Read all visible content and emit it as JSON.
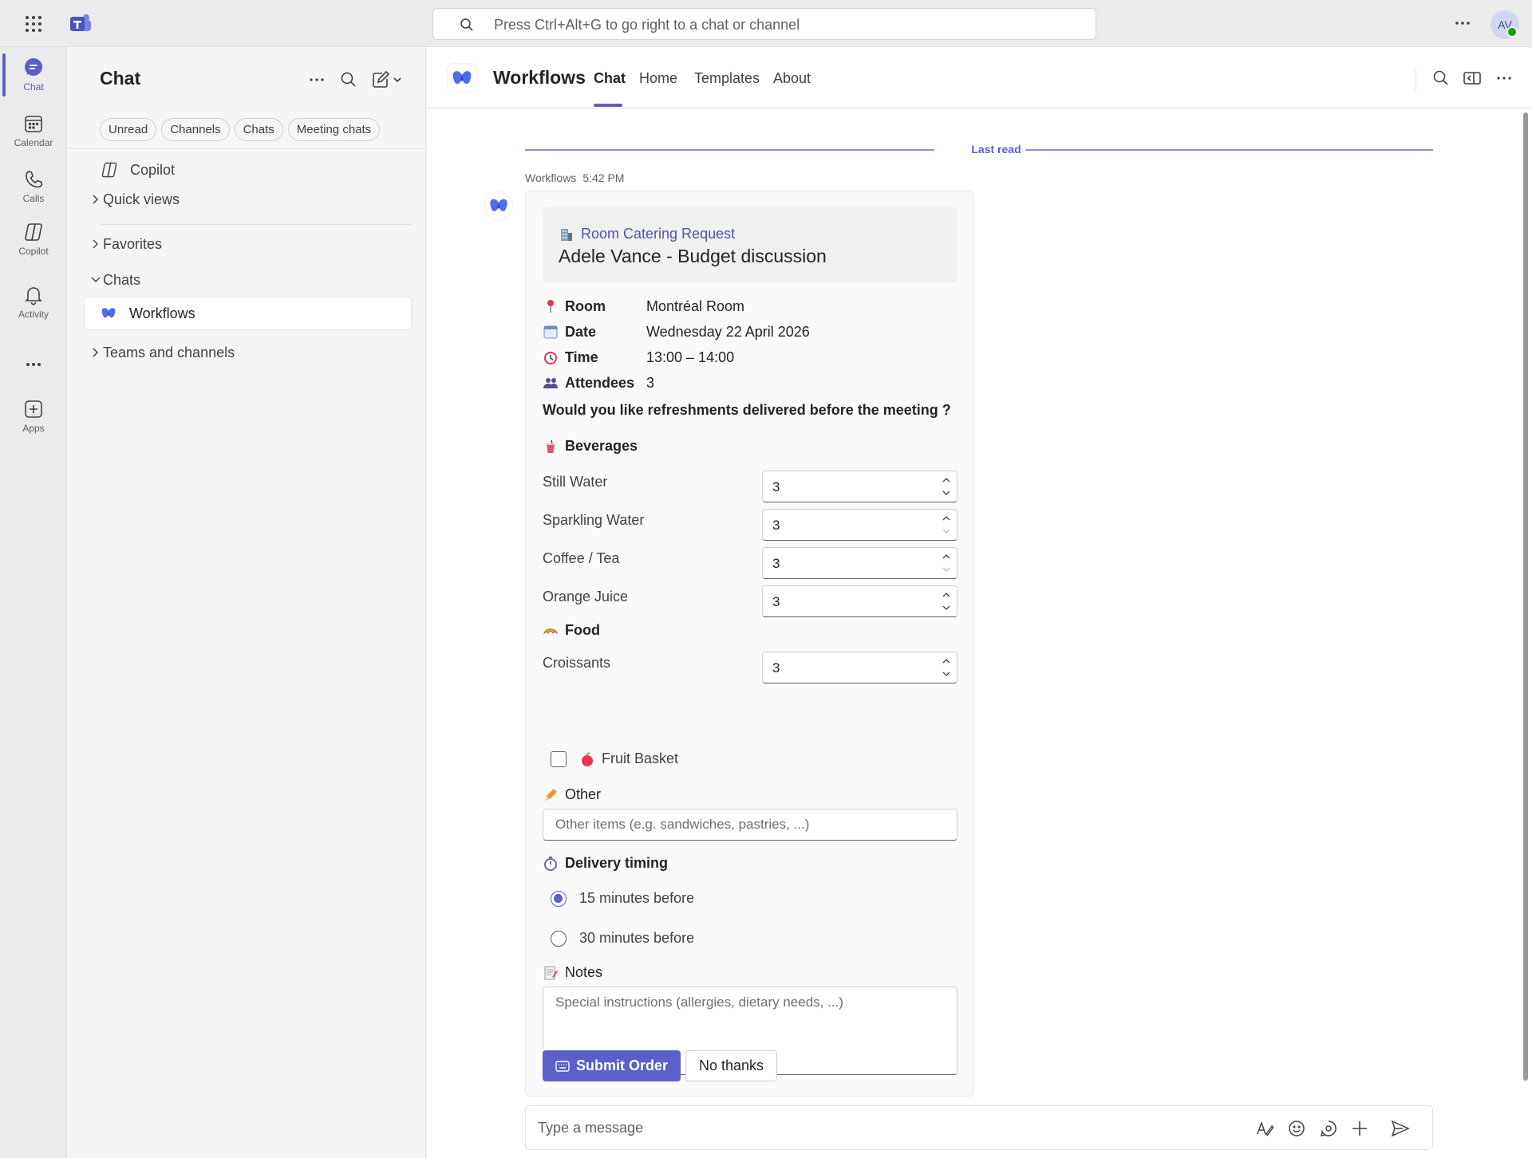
{
  "topbar": {
    "search_placeholder": "Press Ctrl+Alt+G to go right to a chat or channel",
    "avatar_initials": "AV"
  },
  "rail": {
    "items": [
      {
        "label": "Chat",
        "icon": "chat-icon"
      },
      {
        "label": "Calendar",
        "icon": "calendar-icon"
      },
      {
        "label": "Calls",
        "icon": "phone-icon"
      },
      {
        "label": "Copilot",
        "icon": "copilot-icon"
      },
      {
        "label": "Activity",
        "icon": "bell-icon"
      },
      {
        "label": "Apps",
        "icon": "add-app-icon"
      }
    ]
  },
  "chatlist": {
    "title": "Chat",
    "filters": [
      "Unread",
      "Channels",
      "Chats",
      "Meeting chats"
    ],
    "copilot": "Copilot",
    "quick_views": "Quick views",
    "favorites": "Favorites",
    "chats": "Chats",
    "workflows": "Workflows",
    "teams": "Teams and channels"
  },
  "main": {
    "app_title": "Workflows",
    "tabs": [
      "Chat",
      "Home",
      "Templates",
      "About"
    ],
    "last_read": "Last read",
    "sender": "Workflows",
    "time": "5:42 PM",
    "composer_placeholder": "Type a message"
  },
  "card": {
    "subtitle": "Room Catering Request",
    "title": "Adele Vance - Budget discussion",
    "facts": [
      {
        "key": "Room",
        "value": "Montréal Room",
        "icon": "pin-icon"
      },
      {
        "key": "Date",
        "value": "Wednesday 22 April 2026",
        "icon": "calendar-icon"
      },
      {
        "key": "Time",
        "value": "13:00 – 14:00",
        "icon": "alarm-clock-icon"
      },
      {
        "key": "Attendees",
        "value": "3",
        "icon": "people-icon"
      }
    ],
    "question": "Would you like refreshments delivered before the meeting ?",
    "beverages_label": "Beverages",
    "beverages": [
      {
        "label": "Still Water",
        "value": "3"
      },
      {
        "label": "Sparkling Water",
        "value": "3"
      },
      {
        "label": "Coffee / Tea",
        "value": "3"
      },
      {
        "label": "Orange Juice",
        "value": "3"
      }
    ],
    "food_label": "Food",
    "food": [
      {
        "label": "Croissants",
        "value": "3"
      }
    ],
    "fruit_basket": "Fruit Basket",
    "other_label": "Other",
    "other_placeholder": "Other items (e.g. sandwiches, pastries, ...)",
    "timing_label": "Delivery timing",
    "timing_options": [
      "15 minutes before",
      "30 minutes before"
    ],
    "timing_selected": 0,
    "notes_label": "Notes",
    "notes_placeholder": "Special instructions (allergies, dietary needs, ...)",
    "submit_label": "Submit Order",
    "decline_label": "No thanks"
  },
  "colors": {
    "accent": "#5b5fc7",
    "link": "#4f52b2",
    "presence": "#13a10e"
  }
}
